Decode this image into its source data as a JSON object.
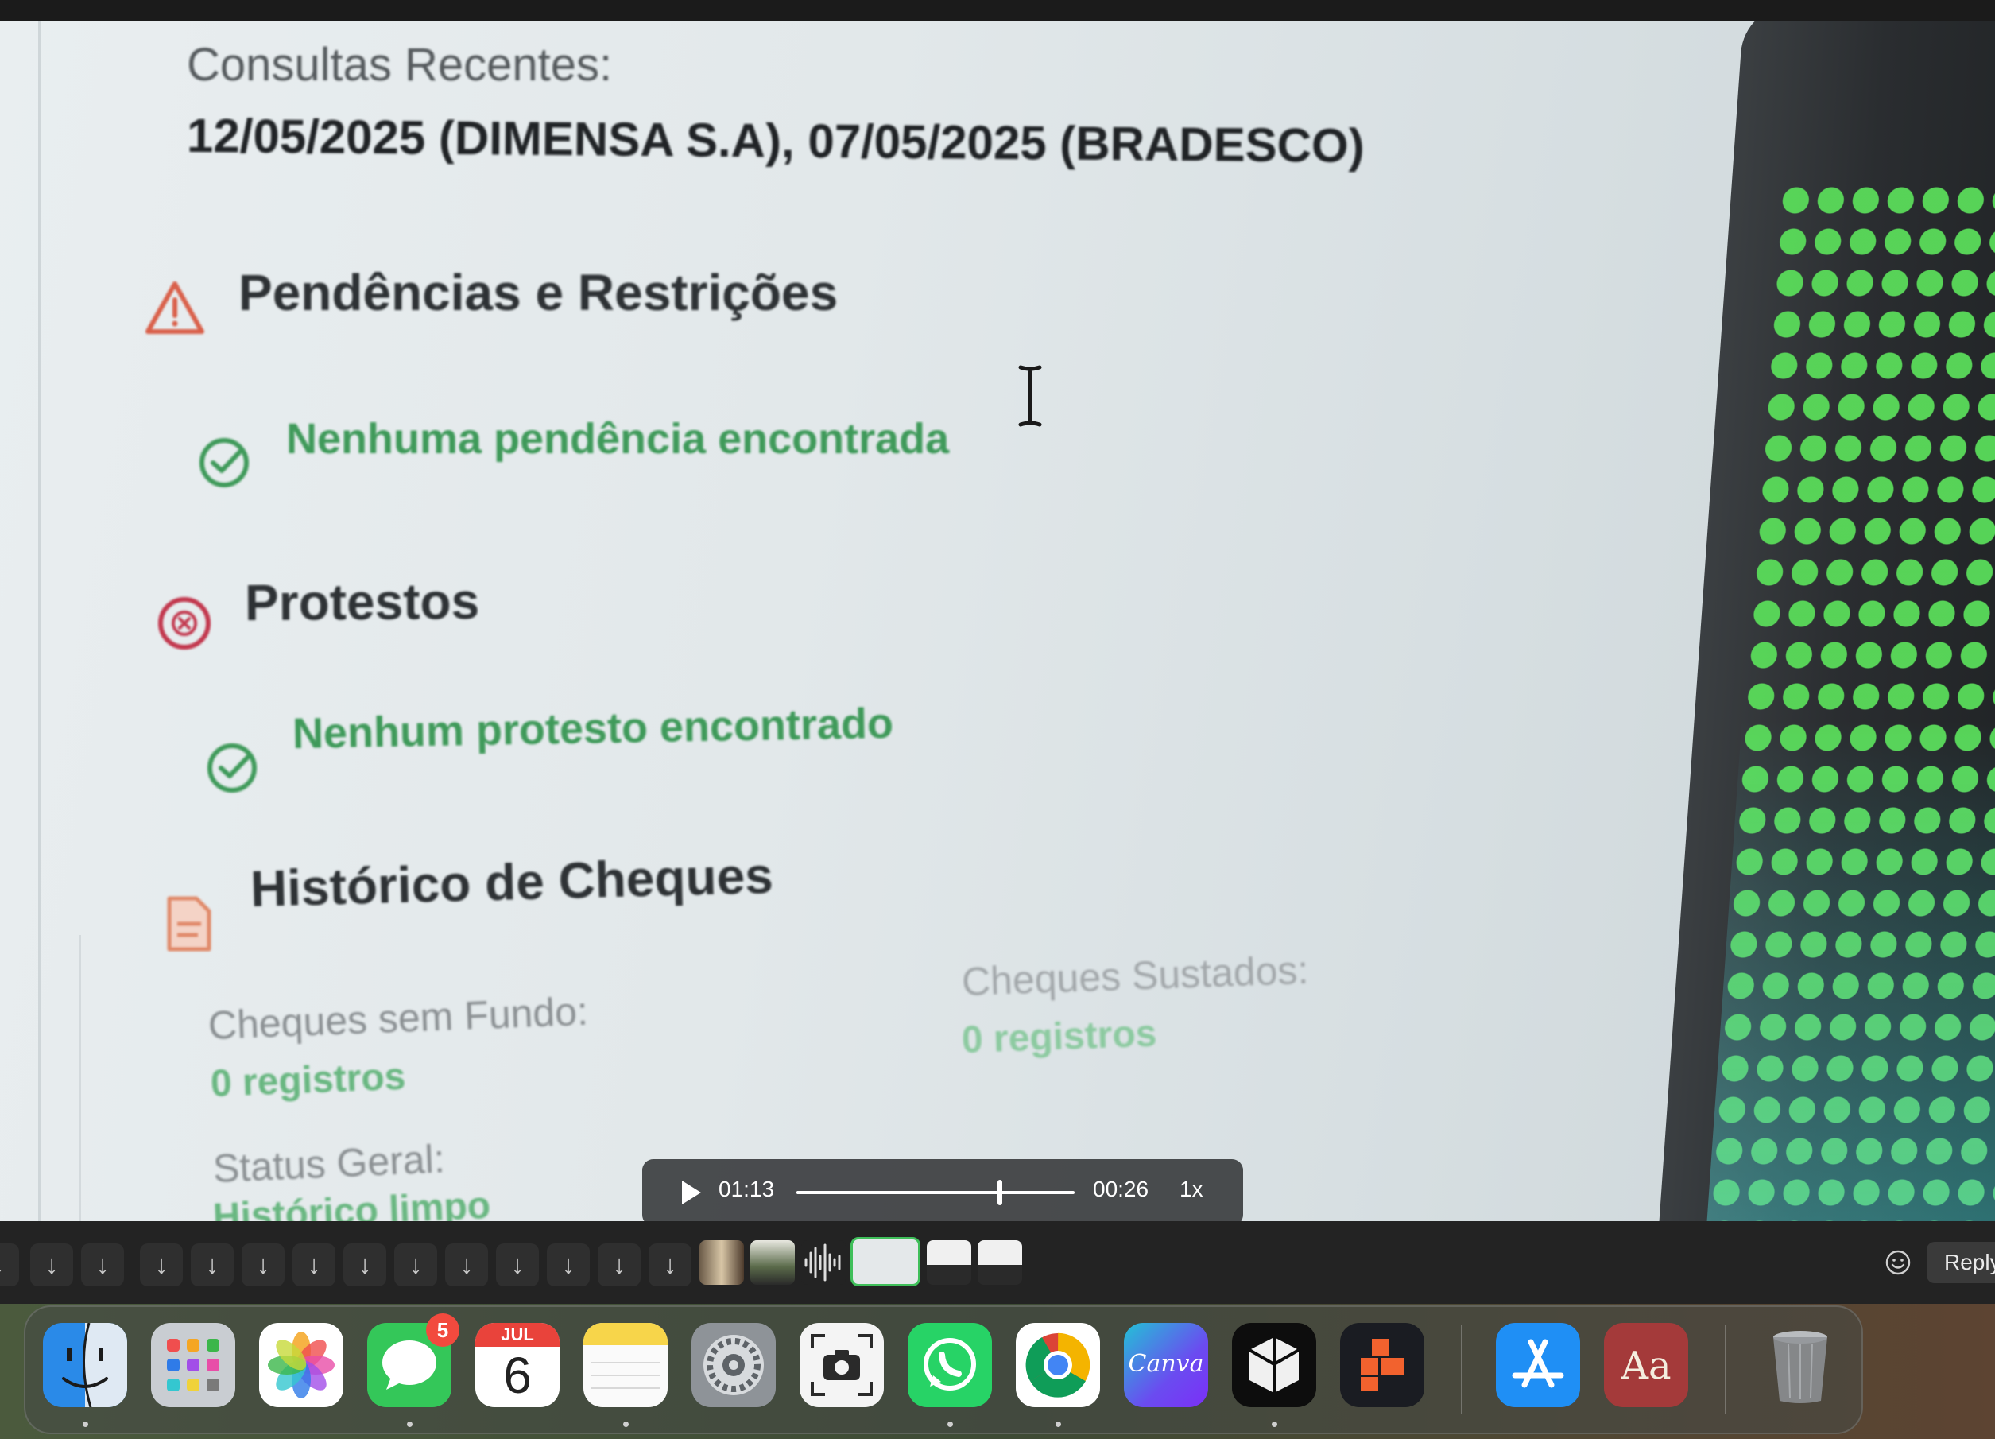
{
  "report": {
    "recent_queries_label": "Consultas Recentes:",
    "recent_queries_value": "12/05/2025 (DIMENSA S.A), 07/05/2025 (BRADESCO)",
    "pendencias": {
      "title": "Pendências e Restrições",
      "status": "Nenhuma pendência encontrada"
    },
    "protestos": {
      "title": "Protestos",
      "status": "Nenhum protesto encontrado"
    },
    "cheques": {
      "title": "Histórico de Cheques",
      "sem_fundo_label": "Cheques sem Fundo:",
      "sem_fundo_value": "0 registros",
      "sustados_label": "Cheques Sustados:",
      "sustados_value": "0 registros",
      "status_label": "Status Geral:",
      "status_value": "Histórico limpo"
    }
  },
  "player": {
    "elapsed": "01:13",
    "remaining": "00:26",
    "speed": "1x",
    "progress": 0.73
  },
  "message_bar": {
    "reply_label": "Reply"
  },
  "dock": {
    "messages_badge": "5",
    "calendar_month": "JUL",
    "calendar_day": "6",
    "canva_label": "Canva",
    "dictionary_label": "Aa"
  },
  "colors": {
    "success_green": "#3f9a5a",
    "warning_red": "#d9604a",
    "protest_red": "#c2384e",
    "cheque_orange": "#e08a6a",
    "selected_border": "#3fbf5a"
  }
}
